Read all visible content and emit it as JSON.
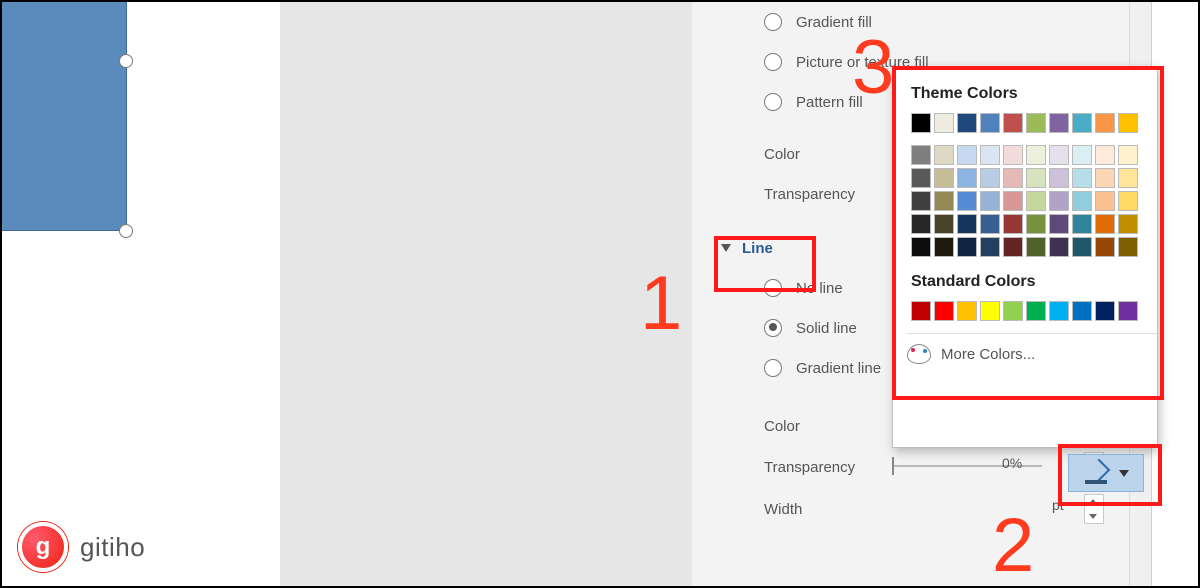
{
  "fill": {
    "options": {
      "gradient": "Gradient fill",
      "picture": "Picture or texture fill",
      "pattern": "Pattern fill"
    },
    "color_label": "Color",
    "transparency_label": "Transparency"
  },
  "line": {
    "header": "Line",
    "options": {
      "none": "No line",
      "solid": "Solid line",
      "gradient": "Gradient line"
    },
    "selected": "solid",
    "color_label": "Color",
    "transparency_label": "Transparency",
    "transparency_value": "0%",
    "width_label": "Width",
    "width_unit": "pt"
  },
  "color_popup": {
    "theme_header": "Theme Colors",
    "theme_row": [
      "#000000",
      "#eeece1",
      "#1f497d",
      "#4f81bd",
      "#c0504d",
      "#9bbb59",
      "#8064a2",
      "#4bacc6",
      "#f79646",
      "#ffc000"
    ],
    "tints": [
      [
        "#7f7f7f",
        "#ddd9c3",
        "#c6d9f0",
        "#dbe5f1",
        "#f2dcdb",
        "#ebf1dd",
        "#e5e0ec",
        "#dbeef3",
        "#fdeada",
        "#fff2cc"
      ],
      [
        "#595959",
        "#c4bd97",
        "#8db3e2",
        "#b8cce4",
        "#e5b9b7",
        "#d7e3bc",
        "#ccc1d9",
        "#b7dde8",
        "#fbd5b5",
        "#ffe599"
      ],
      [
        "#3f3f3f",
        "#938953",
        "#548dd4",
        "#95b3d7",
        "#d99694",
        "#c3d69b",
        "#b2a2c7",
        "#92cddc",
        "#fac08f",
        "#ffd966"
      ],
      [
        "#262626",
        "#494429",
        "#17365d",
        "#366092",
        "#953734",
        "#76923c",
        "#5f497a",
        "#31859b",
        "#e36c09",
        "#bf8f00"
      ],
      [
        "#0c0c0c",
        "#1d1b10",
        "#0f243e",
        "#244061",
        "#632423",
        "#4f6128",
        "#3f3151",
        "#205867",
        "#974806",
        "#7f6000"
      ]
    ],
    "standard_header": "Standard Colors",
    "standard_row": [
      "#c00000",
      "#ff0000",
      "#ffc000",
      "#ffff00",
      "#92d050",
      "#00b050",
      "#00b0f0",
      "#0070c0",
      "#002060",
      "#7030a0"
    ],
    "more_label": "More Colors..."
  },
  "annotations": {
    "a1": "1",
    "a2": "2",
    "a3": "3"
  },
  "brand": "gitiho"
}
